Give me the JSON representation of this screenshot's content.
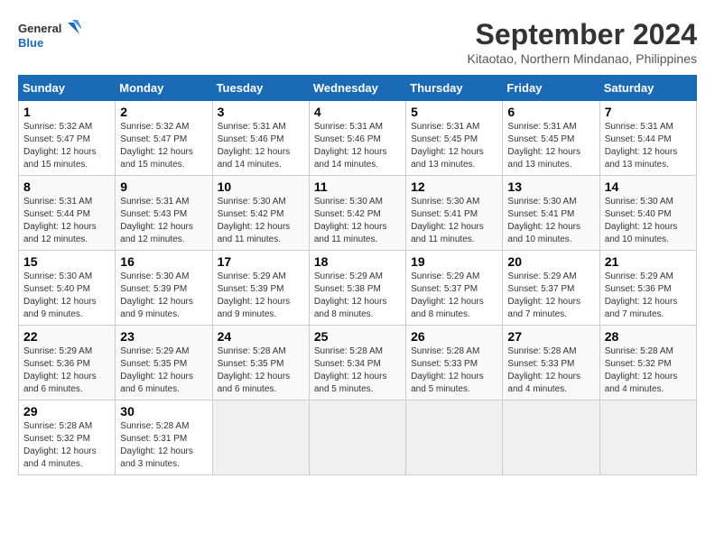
{
  "logo": {
    "line1": "General",
    "line2": "Blue"
  },
  "title": "September 2024",
  "subtitle": "Kitaotao, Northern Mindanao, Philippines",
  "days_of_week": [
    "Sunday",
    "Monday",
    "Tuesday",
    "Wednesday",
    "Thursday",
    "Friday",
    "Saturday"
  ],
  "weeks": [
    [
      {
        "day": "1",
        "info": "Sunrise: 5:32 AM\nSunset: 5:47 PM\nDaylight: 12 hours\nand 15 minutes."
      },
      {
        "day": "2",
        "info": "Sunrise: 5:32 AM\nSunset: 5:47 PM\nDaylight: 12 hours\nand 15 minutes."
      },
      {
        "day": "3",
        "info": "Sunrise: 5:31 AM\nSunset: 5:46 PM\nDaylight: 12 hours\nand 14 minutes."
      },
      {
        "day": "4",
        "info": "Sunrise: 5:31 AM\nSunset: 5:46 PM\nDaylight: 12 hours\nand 14 minutes."
      },
      {
        "day": "5",
        "info": "Sunrise: 5:31 AM\nSunset: 5:45 PM\nDaylight: 12 hours\nand 13 minutes."
      },
      {
        "day": "6",
        "info": "Sunrise: 5:31 AM\nSunset: 5:45 PM\nDaylight: 12 hours\nand 13 minutes."
      },
      {
        "day": "7",
        "info": "Sunrise: 5:31 AM\nSunset: 5:44 PM\nDaylight: 12 hours\nand 13 minutes."
      }
    ],
    [
      {
        "day": "8",
        "info": "Sunrise: 5:31 AM\nSunset: 5:44 PM\nDaylight: 12 hours\nand 12 minutes."
      },
      {
        "day": "9",
        "info": "Sunrise: 5:31 AM\nSunset: 5:43 PM\nDaylight: 12 hours\nand 12 minutes."
      },
      {
        "day": "10",
        "info": "Sunrise: 5:30 AM\nSunset: 5:42 PM\nDaylight: 12 hours\nand 11 minutes."
      },
      {
        "day": "11",
        "info": "Sunrise: 5:30 AM\nSunset: 5:42 PM\nDaylight: 12 hours\nand 11 minutes."
      },
      {
        "day": "12",
        "info": "Sunrise: 5:30 AM\nSunset: 5:41 PM\nDaylight: 12 hours\nand 11 minutes."
      },
      {
        "day": "13",
        "info": "Sunrise: 5:30 AM\nSunset: 5:41 PM\nDaylight: 12 hours\nand 10 minutes."
      },
      {
        "day": "14",
        "info": "Sunrise: 5:30 AM\nSunset: 5:40 PM\nDaylight: 12 hours\nand 10 minutes."
      }
    ],
    [
      {
        "day": "15",
        "info": "Sunrise: 5:30 AM\nSunset: 5:40 PM\nDaylight: 12 hours\nand 9 minutes."
      },
      {
        "day": "16",
        "info": "Sunrise: 5:30 AM\nSunset: 5:39 PM\nDaylight: 12 hours\nand 9 minutes."
      },
      {
        "day": "17",
        "info": "Sunrise: 5:29 AM\nSunset: 5:39 PM\nDaylight: 12 hours\nand 9 minutes."
      },
      {
        "day": "18",
        "info": "Sunrise: 5:29 AM\nSunset: 5:38 PM\nDaylight: 12 hours\nand 8 minutes."
      },
      {
        "day": "19",
        "info": "Sunrise: 5:29 AM\nSunset: 5:37 PM\nDaylight: 12 hours\nand 8 minutes."
      },
      {
        "day": "20",
        "info": "Sunrise: 5:29 AM\nSunset: 5:37 PM\nDaylight: 12 hours\nand 7 minutes."
      },
      {
        "day": "21",
        "info": "Sunrise: 5:29 AM\nSunset: 5:36 PM\nDaylight: 12 hours\nand 7 minutes."
      }
    ],
    [
      {
        "day": "22",
        "info": "Sunrise: 5:29 AM\nSunset: 5:36 PM\nDaylight: 12 hours\nand 6 minutes."
      },
      {
        "day": "23",
        "info": "Sunrise: 5:29 AM\nSunset: 5:35 PM\nDaylight: 12 hours\nand 6 minutes."
      },
      {
        "day": "24",
        "info": "Sunrise: 5:28 AM\nSunset: 5:35 PM\nDaylight: 12 hours\nand 6 minutes."
      },
      {
        "day": "25",
        "info": "Sunrise: 5:28 AM\nSunset: 5:34 PM\nDaylight: 12 hours\nand 5 minutes."
      },
      {
        "day": "26",
        "info": "Sunrise: 5:28 AM\nSunset: 5:33 PM\nDaylight: 12 hours\nand 5 minutes."
      },
      {
        "day": "27",
        "info": "Sunrise: 5:28 AM\nSunset: 5:33 PM\nDaylight: 12 hours\nand 4 minutes."
      },
      {
        "day": "28",
        "info": "Sunrise: 5:28 AM\nSunset: 5:32 PM\nDaylight: 12 hours\nand 4 minutes."
      }
    ],
    [
      {
        "day": "29",
        "info": "Sunrise: 5:28 AM\nSunset: 5:32 PM\nDaylight: 12 hours\nand 4 minutes."
      },
      {
        "day": "30",
        "info": "Sunrise: 5:28 AM\nSunset: 5:31 PM\nDaylight: 12 hours\nand 3 minutes."
      },
      {
        "day": "",
        "info": ""
      },
      {
        "day": "",
        "info": ""
      },
      {
        "day": "",
        "info": ""
      },
      {
        "day": "",
        "info": ""
      },
      {
        "day": "",
        "info": ""
      }
    ]
  ]
}
